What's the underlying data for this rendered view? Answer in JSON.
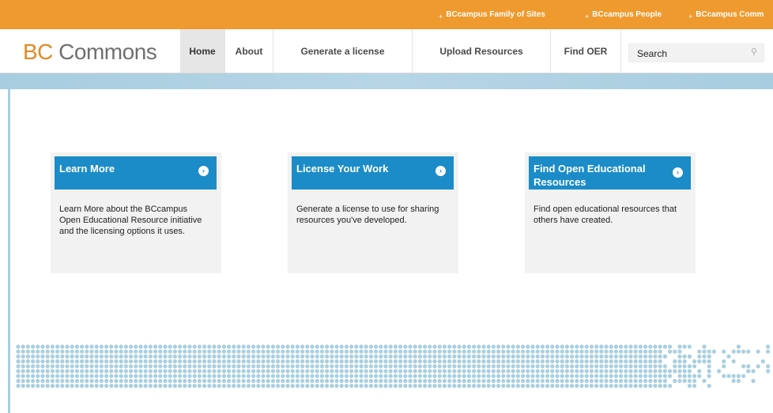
{
  "topbar": {
    "links": [
      "BCcampus Family of Sites",
      "BCcampus People",
      "BCcampus Comm"
    ]
  },
  "header": {
    "logo_prefix": "BC",
    "logo_rest": " Commons",
    "nav": [
      "Home",
      "About",
      "Generate a license",
      "Upload Resources",
      "Find OER"
    ],
    "search_value": "Search"
  },
  "cards": [
    {
      "title": "Learn More",
      "body": "Learn More about the BCcampus Open Educational Resource initiative and the licensing options it uses."
    },
    {
      "title": "License Your Work",
      "body": "Generate a license to use for sharing resources you've developed."
    },
    {
      "title": "Find Open Educational Resources",
      "body": "Find open educational resources that others have created."
    }
  ],
  "colors": {
    "orange": "#ef9a2e",
    "blue": "#1b8cc8",
    "dots": "#a9cfe0"
  }
}
